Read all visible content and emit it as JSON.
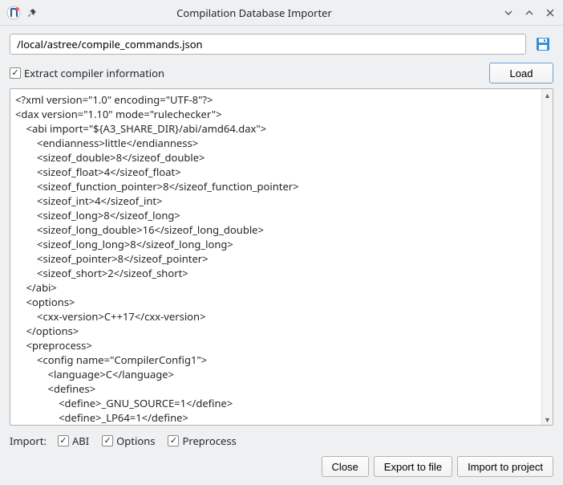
{
  "window": {
    "title": "Compilation Database Importer"
  },
  "path": {
    "value": "/local/astree/compile_commands.json"
  },
  "extract": {
    "label": "Extract compiler information",
    "checked": true
  },
  "load_btn": "Load",
  "xml": "<?xml version=\"1.0\" encoding=\"UTF-8\"?>\n<dax version=\"1.10\" mode=\"rulechecker\">\n    <abi import=\"${A3_SHARE_DIR}/abi/amd64.dax\">\n        <endianness>little</endianness>\n        <sizeof_double>8</sizeof_double>\n        <sizeof_float>4</sizeof_float>\n        <sizeof_function_pointer>8</sizeof_function_pointer>\n        <sizeof_int>4</sizeof_int>\n        <sizeof_long>8</sizeof_long>\n        <sizeof_long_double>16</sizeof_long_double>\n        <sizeof_long_long>8</sizeof_long_long>\n        <sizeof_pointer>8</sizeof_pointer>\n        <sizeof_short>2</sizeof_short>\n    </abi>\n    <options>\n        <cxx-version>C++17</cxx-version>\n    </options>\n    <preprocess>\n        <config name=\"CompilerConfig1\">\n            <language>C</language>\n            <defines>\n                <define>_GNU_SOURCE=1</define>\n                <define>_LP64=1</define>",
  "import": {
    "label": "Import:",
    "abi": {
      "label": "ABI",
      "checked": true
    },
    "options": {
      "label": "Options",
      "checked": true
    },
    "preprocess": {
      "label": "Preprocess",
      "checked": true
    }
  },
  "footer": {
    "close": "Close",
    "export": "Export to file",
    "import_proj": "Import to project"
  }
}
